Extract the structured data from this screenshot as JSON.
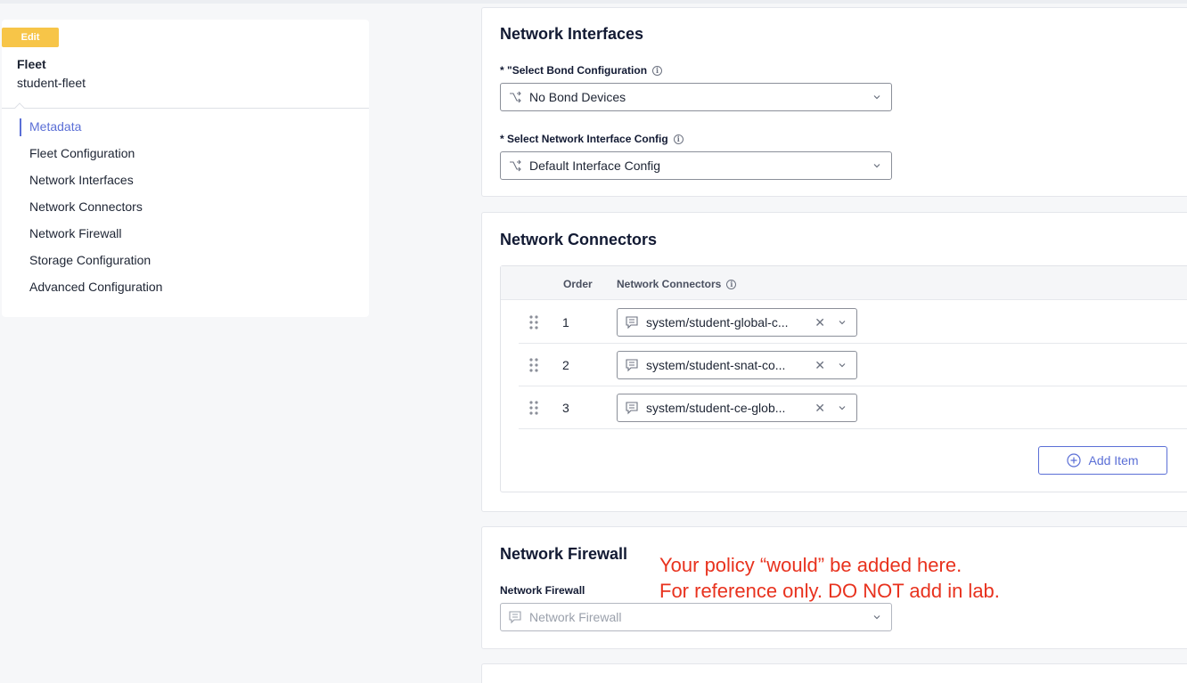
{
  "sidebar": {
    "edit_badge": "Edit",
    "fleet_label": "Fleet",
    "fleet_name": "student-fleet",
    "nav_items": [
      {
        "label": "Metadata",
        "active": true
      },
      {
        "label": "Fleet Configuration"
      },
      {
        "label": "Network Interfaces"
      },
      {
        "label": "Network Connectors"
      },
      {
        "label": "Network Firewall"
      },
      {
        "label": "Storage Configuration"
      },
      {
        "label": "Advanced Configuration"
      }
    ]
  },
  "network_interfaces": {
    "title": "Network Interfaces",
    "bond_label": "* \"Select Bond Configuration",
    "bond_value": "No Bond Devices",
    "interface_label": "* Select Network Interface Config",
    "interface_value": "Default Interface Config"
  },
  "network_connectors": {
    "title": "Network Connectors",
    "columns": [
      "Order",
      "Network Connectors"
    ],
    "rows": [
      {
        "order": "1",
        "value": "system/student-global-c..."
      },
      {
        "order": "2",
        "value": "system/student-snat-co..."
      },
      {
        "order": "3",
        "value": "system/student-ce-glob..."
      }
    ],
    "add_item_label": "Add Item"
  },
  "network_firewall": {
    "title": "Network Firewall",
    "field_label": "Network Firewall",
    "placeholder": "Network Firewall"
  },
  "annotation": {
    "line1": "Your policy “would” be added here.",
    "line2": "For reference only. DO NOT add in lab."
  },
  "colors": {
    "accent": "#5b6fd6",
    "badge": "#f7c548",
    "annotation": "#e8321e"
  }
}
